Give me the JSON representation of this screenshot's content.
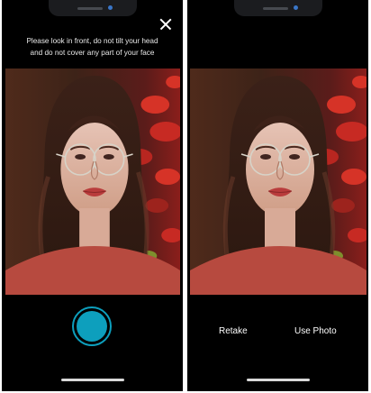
{
  "camera_screen": {
    "instruction": "Please look in front, do not tilt your head\nand do not cover any part of your face",
    "close_icon": "close-icon",
    "shutter_icon": "shutter-button",
    "accent_color": "#0d9fbd"
  },
  "review_screen": {
    "retake_label": "Retake",
    "use_photo_label": "Use Photo"
  },
  "colors": {
    "background": "#000000",
    "text": "#ffffff"
  }
}
